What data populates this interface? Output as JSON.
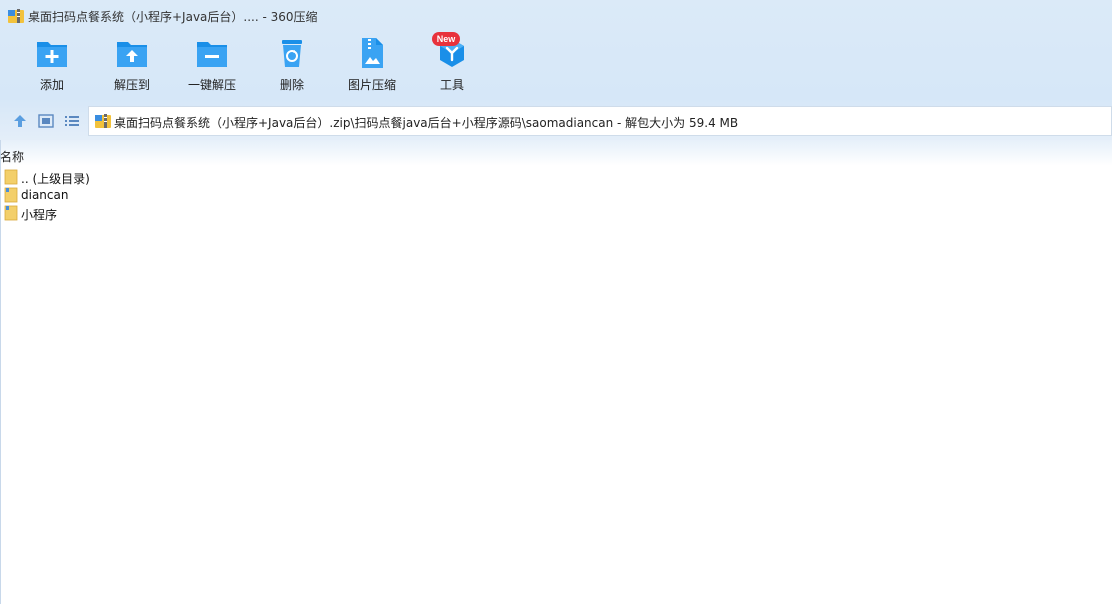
{
  "window": {
    "title": "桌面扫码点餐系统（小程序+Java后台）.... - 360压缩",
    "app_icon": "360zip-app-icon"
  },
  "toolbar": {
    "items": [
      {
        "label": "添加",
        "icon": "add-icon"
      },
      {
        "label": "解压到",
        "icon": "extract-to-icon"
      },
      {
        "label": "一键解压",
        "icon": "one-click-extract-icon"
      },
      {
        "label": "删除",
        "icon": "delete-icon"
      },
      {
        "label": "图片压缩",
        "icon": "image-compress-icon"
      },
      {
        "label": "工具",
        "icon": "tools-icon",
        "badge": "New"
      }
    ]
  },
  "nav": {
    "buttons": [
      "up-icon",
      "view-icon",
      "list-view-icon"
    ],
    "path": "桌面扫码点餐系统（小程序+Java后台）.zip\\扫码点餐java后台+小程序源码\\saomadiancan - 解包大小为 59.4 MB"
  },
  "filelist": {
    "column_name": "名称",
    "rows": [
      {
        "name": ".. (上级目录)",
        "type": "parent-folder"
      },
      {
        "name": "diancan",
        "type": "folder"
      },
      {
        "name": "小程序",
        "type": "folder"
      }
    ]
  },
  "colors": {
    "accent": "#1a8fe8",
    "header_bg": "#d6e7f8",
    "badge": "#e8323c",
    "folder": "#f3cf6a"
  }
}
